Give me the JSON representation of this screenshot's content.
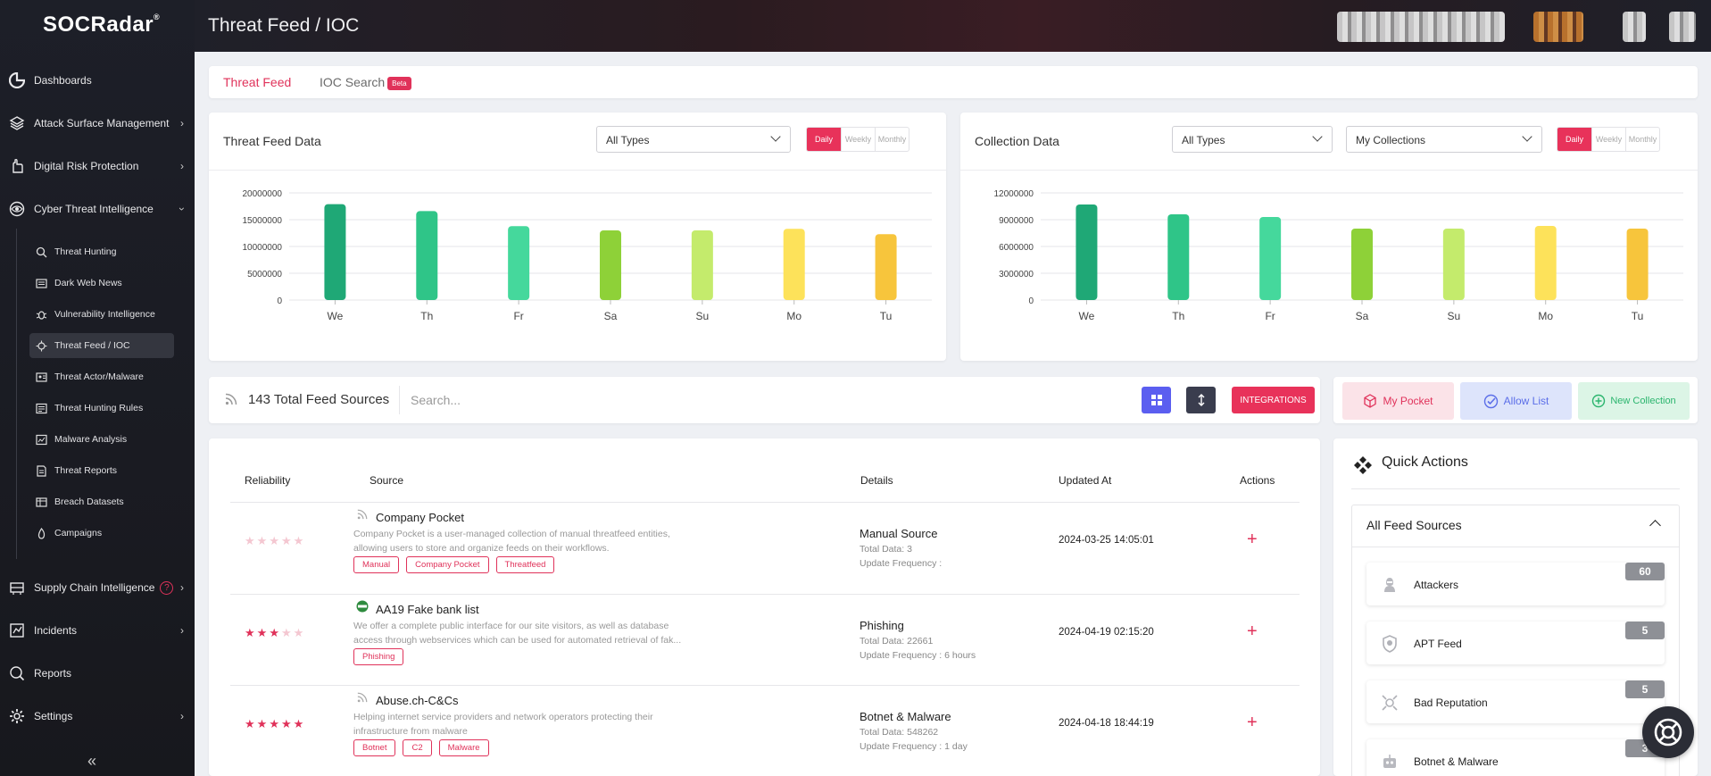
{
  "app": {
    "brand": "SOCRadar",
    "page_title": "Threat Feed / IOC"
  },
  "sidebar": {
    "items": [
      {
        "label": "Dashboards",
        "icon": "dashboard-icon"
      },
      {
        "label": "Attack Surface Management",
        "icon": "layers-icon"
      },
      {
        "label": "Digital Risk Protection",
        "icon": "hand-icon"
      },
      {
        "label": "Cyber Threat Intelligence",
        "icon": "eye-icon"
      },
      {
        "label": "Supply Chain Intelligence",
        "icon": "supply-chain-icon"
      },
      {
        "label": "Incidents",
        "icon": "incidents-icon"
      },
      {
        "label": "Reports",
        "icon": "reports-icon"
      },
      {
        "label": "Settings",
        "icon": "gear-icon"
      }
    ],
    "cti_subitems": [
      {
        "label": "Threat Hunting",
        "icon": "magnifier-icon"
      },
      {
        "label": "Dark Web News",
        "icon": "newspaper-icon"
      },
      {
        "label": "Vulnerability Intelligence",
        "icon": "bug-icon"
      },
      {
        "label": "Threat Feed / IOC",
        "icon": "virus-icon"
      },
      {
        "label": "Threat Actor/Malware",
        "icon": "actor-icon"
      },
      {
        "label": "Threat Hunting Rules",
        "icon": "rules-icon"
      },
      {
        "label": "Malware Analysis",
        "icon": "malware-icon"
      },
      {
        "label": "Threat Reports",
        "icon": "report-icon"
      },
      {
        "label": "Breach Datasets",
        "icon": "dataset-icon"
      },
      {
        "label": "Campaigns",
        "icon": "flame-icon"
      }
    ],
    "help_badge": "?"
  },
  "tabs": [
    {
      "label": "Threat Feed"
    },
    {
      "label": "IOC Search",
      "badge": "Beta"
    }
  ],
  "threat_feed_panel": {
    "title": "Threat Feed Data",
    "type_select": "All Types",
    "periods": [
      "Daily",
      "Weekly",
      "Monthly"
    ]
  },
  "collection_panel": {
    "title": "Collection Data",
    "type_select": "All Types",
    "collection_select": "My Collections",
    "periods": [
      "Daily",
      "Weekly",
      "Monthly"
    ]
  },
  "chart_data": [
    {
      "type": "bar",
      "categories": [
        "We",
        "Th",
        "Fr",
        "Sa",
        "Su",
        "Mo",
        "Tu"
      ],
      "values": [
        17900000,
        16600000,
        13800000,
        13000000,
        13000000,
        13300000,
        12300000
      ],
      "ylim": [
        0,
        20000000
      ],
      "yticks": [
        "0",
        "5000000",
        "10000000",
        "15000000",
        "20000000"
      ],
      "colors": [
        "#1fa876",
        "#2fc588",
        "#45d89c",
        "#8ed138",
        "#c4eb6c",
        "#fde25a",
        "#f7c53c"
      ],
      "grid": true
    },
    {
      "type": "bar",
      "categories": [
        "We",
        "Th",
        "Fr",
        "Sa",
        "Su",
        "Mo",
        "Tu"
      ],
      "values": [
        10700000,
        9600000,
        9300000,
        8000000,
        8000000,
        8300000,
        8000000
      ],
      "ylim": [
        0,
        12000000
      ],
      "yticks": [
        "0",
        "3000000",
        "6000000",
        "9000000",
        "12000000"
      ],
      "colors": [
        "#1fa876",
        "#2fc588",
        "#45d89c",
        "#8ed138",
        "#c4eb6c",
        "#fde25a",
        "#f7c53c"
      ],
      "grid": true
    }
  ],
  "feed_bar": {
    "count_text": "143 Total Feed Sources",
    "search_placeholder": "Search...",
    "integrations_label": "INTEGRATIONS"
  },
  "action_buttons": {
    "pocket": "My Pocket",
    "allow": "Allow List",
    "new_collection": "New Collection"
  },
  "table": {
    "headers": [
      "Reliability",
      "Source",
      "Details",
      "Updated At",
      "Actions"
    ],
    "rows": [
      {
        "rating": 0,
        "name": "Company Pocket",
        "desc1": "Company Pocket is a user-managed collection of manual threatfeed entities,",
        "desc2": "allowing users to store and organize feeds on their workflows.",
        "tags": [
          "Manual",
          "Company Pocket",
          "Threatfeed"
        ],
        "detail_title": "Manual Source",
        "total": "Total Data: 3",
        "freq": "Update Frequency :",
        "updated": "2024-03-25 14:05:01"
      },
      {
        "rating": 3,
        "name": "AA19 Fake bank list",
        "desc1": "We offer a complete public interface for our site visitors, as well as database",
        "desc2": "access through webservices which can be used for automated retrieval of fak...",
        "tags": [
          "Phishing"
        ],
        "detail_title": "Phishing",
        "total": "Total Data: 22661",
        "freq": "Update Frequency : 6 hours",
        "updated": "2024-04-19 02:15:20"
      },
      {
        "rating": 5,
        "name": "Abuse.ch-C&Cs",
        "desc1": "Helping internet service providers and network operators protecting their",
        "desc2": "infrastructure from malware",
        "tags": [
          "Botnet",
          "C2",
          "Malware"
        ],
        "detail_title": "Botnet & Malware",
        "total": "Total Data: 548262",
        "freq": "Update Frequency : 1 day",
        "updated": "2024-04-18 18:44:19"
      }
    ]
  },
  "quick_actions": {
    "title": "Quick Actions",
    "section": "All Feed Sources",
    "items": [
      {
        "label": "Attackers",
        "count": "60",
        "icon": "hacker-icon"
      },
      {
        "label": "APT Feed",
        "count": "5",
        "icon": "shield-icon"
      },
      {
        "label": "Bad Reputation",
        "count": "5",
        "icon": "target-icon"
      },
      {
        "label": "Botnet & Malware",
        "count": "3",
        "icon": "robot-icon"
      }
    ]
  },
  "colors": {
    "accent": "#e0325a",
    "sidebar_bg": "#1d1f28",
    "purple_btn": "#5b5ef0",
    "dark_btn": "#3a3d4e"
  }
}
